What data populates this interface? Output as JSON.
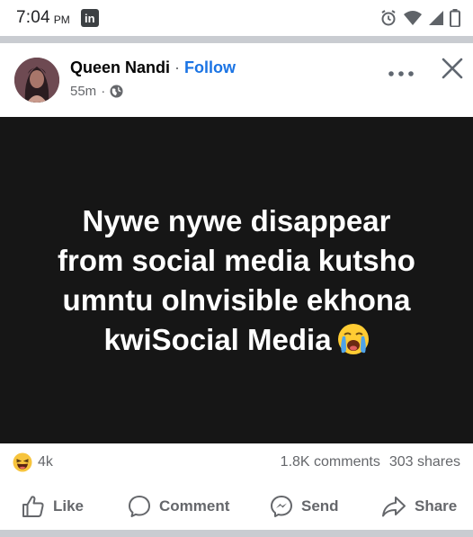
{
  "status_bar": {
    "time": "7:04",
    "ampm": "PM",
    "app_icon": "linkedin-icon",
    "app_icon_text": "in",
    "icons": [
      "alarm-icon",
      "wifi-icon",
      "signal-icon",
      "battery-icon"
    ]
  },
  "post": {
    "author": "Queen Nandi",
    "separator": "·",
    "follow_label": "Follow",
    "time_ago": "55m",
    "meta_separator": "·",
    "privacy_icon": "globe-icon",
    "content_lines": [
      "Nywe nywe disappear",
      "from social media kutsho",
      "umntu oInvisible ekhona",
      "kwiSocial Media"
    ],
    "content_emoji": "loudly-crying-face-emoji",
    "content_background": "#161616"
  },
  "reactions": {
    "icon": "laughing-face-emoji",
    "count": "4k",
    "comments": "1.8K comments",
    "shares": "303 shares"
  },
  "actions": {
    "like": "Like",
    "comment": "Comment",
    "send": "Send",
    "share": "Share"
  },
  "colors": {
    "accent": "#1b74e4",
    "secondary_text": "#65676b",
    "divider": "#c9ccd1"
  }
}
